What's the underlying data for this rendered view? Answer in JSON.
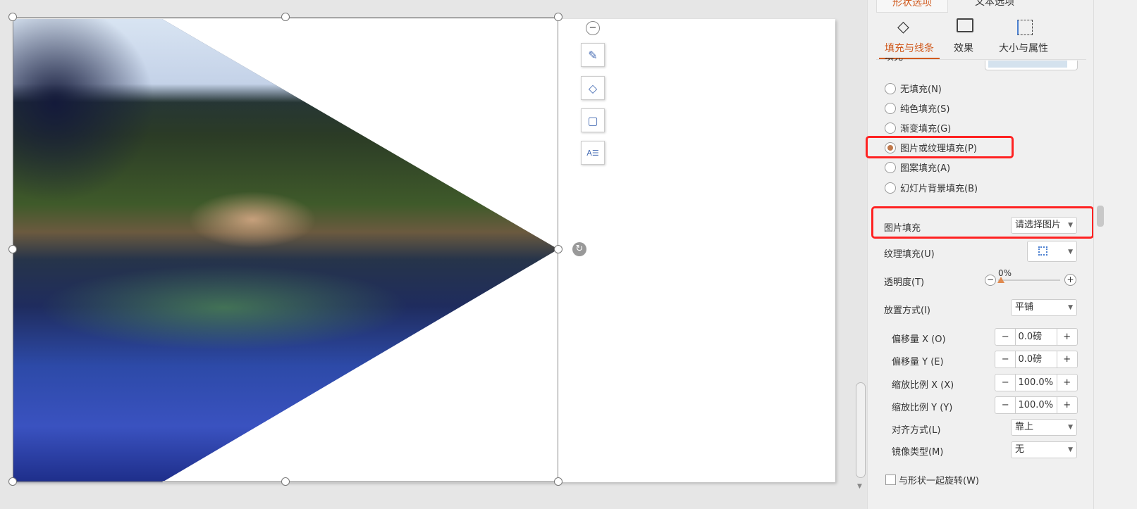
{
  "canvas": {
    "float_tools": [
      "minus-icon",
      "brush-icon",
      "fill-icon",
      "outline-icon",
      "text-wrap-icon"
    ]
  },
  "panel": {
    "top_tabs": [
      "形状选项",
      "文本选项"
    ],
    "sub_tabs": [
      "填充与线条",
      "效果",
      "大小与属性"
    ],
    "fill_section_label": "填充",
    "fill_options": [
      "无填充(N)",
      "纯色填充(S)",
      "渐变填充(G)",
      "图片或纹理填充(P)",
      "图案填充(A)",
      "幻灯片背景填充(B)"
    ],
    "selected_fill": "图片或纹理填充(P)",
    "picture_fill_label": "图片填充",
    "picture_fill_value": "请选择图片",
    "texture_label": "纹理填充(U)",
    "transparency_label": "透明度(T)",
    "transparency_value": "0%",
    "placement_label": "放置方式(I)",
    "placement_value": "平铺",
    "offset_x_label": "偏移量 X (O)",
    "offset_x": "0.0磅",
    "offset_y_label": "偏移量 Y (E)",
    "offset_y": "0.0磅",
    "scale_x_label": "缩放比例 X (X)",
    "scale_x": "100.0%",
    "scale_y_label": "缩放比例 Y (Y)",
    "scale_y": "100.0%",
    "align_label": "对齐方式(L)",
    "align_value": "靠上",
    "mirror_label": "镜像类型(M)",
    "mirror_value": "无",
    "rotate_label": "与形状一起旋转(W)",
    "accent": "#d05a1e"
  }
}
